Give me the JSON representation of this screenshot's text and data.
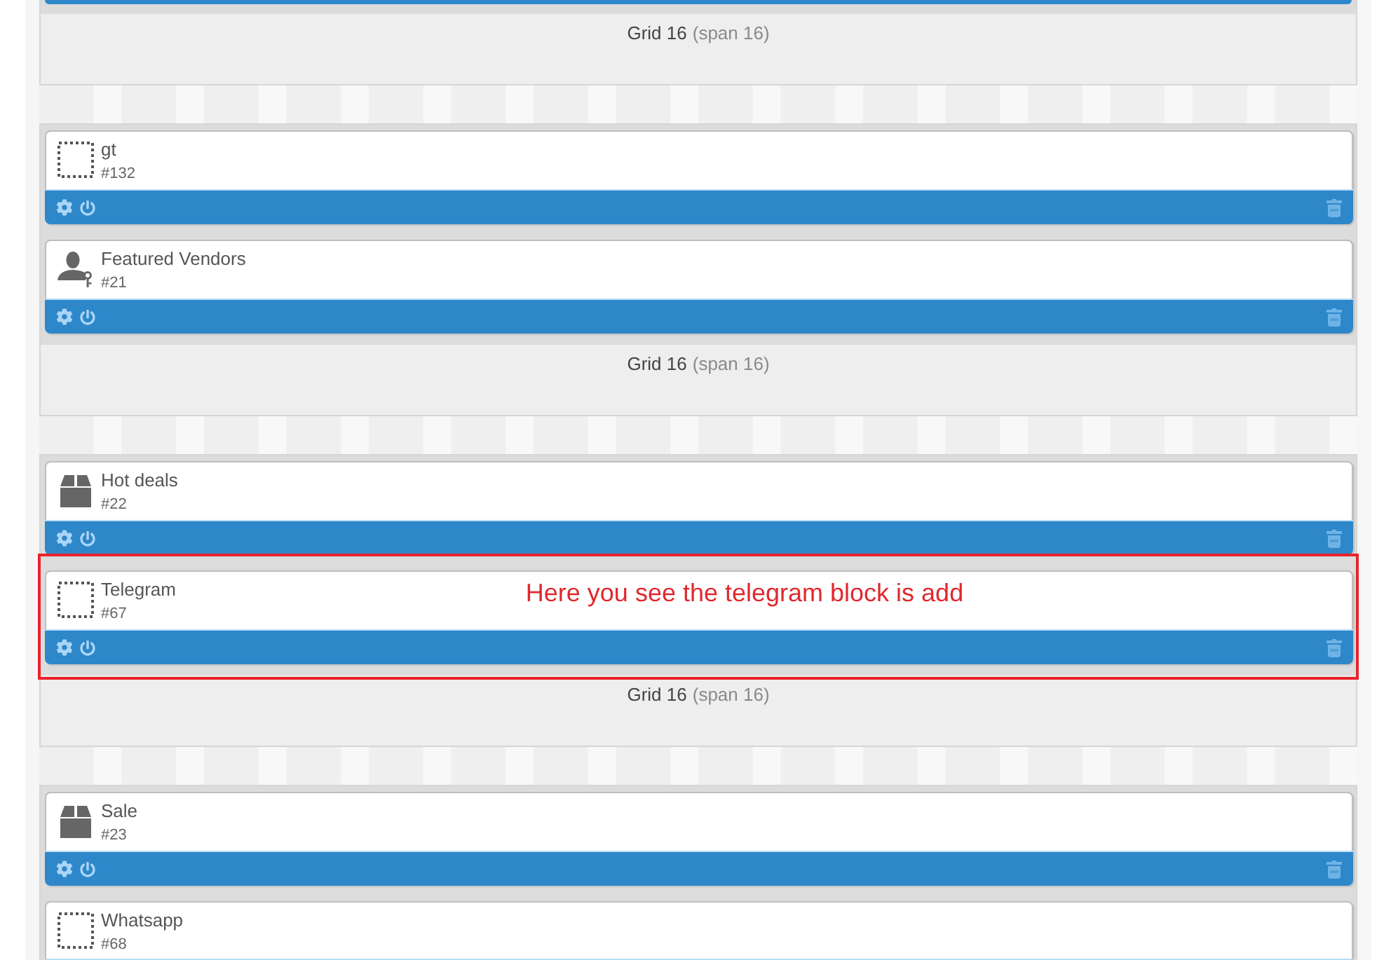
{
  "grids": [
    {
      "clipped_top": true,
      "label": "Grid 16",
      "span": "(span 16)"
    },
    {
      "clipped_top": false,
      "blocks": [
        {
          "kind": "placeholder",
          "title": "gt",
          "id": "#132",
          "toolbar": true
        },
        {
          "kind": "user",
          "title": "Featured Vendors",
          "id": "#21",
          "toolbar": true
        }
      ],
      "label": "Grid 16",
      "span": "(span 16)"
    },
    {
      "clipped_top": false,
      "blocks": [
        {
          "kind": "box",
          "title": "Hot deals",
          "id": "#22",
          "toolbar": true
        },
        {
          "kind": "placeholder",
          "title": "Telegram",
          "id": "#67",
          "toolbar": true,
          "annotation": "Here you see the telegram block is add"
        }
      ],
      "label": "Grid 16",
      "span": "(span 16)"
    },
    {
      "clipped_top": false,
      "blocks": [
        {
          "kind": "box",
          "title": "Sale",
          "id": "#23",
          "toolbar": true
        },
        {
          "kind": "placeholder",
          "title": "Whatsapp",
          "id": "#68",
          "toolbar": false
        }
      ]
    }
  ]
}
